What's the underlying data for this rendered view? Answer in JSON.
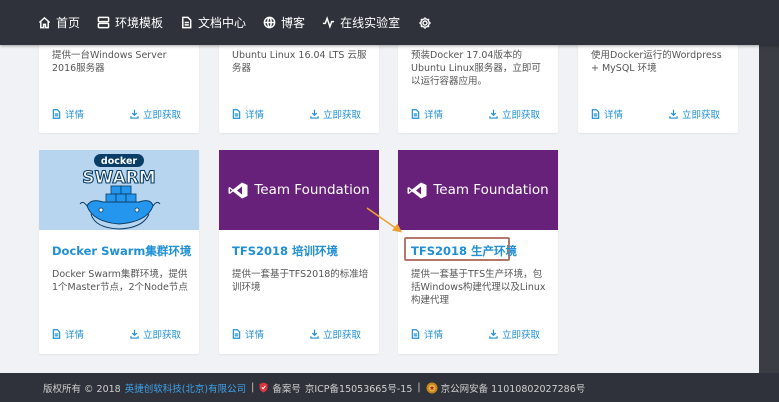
{
  "nav": {
    "items": [
      {
        "label": "首页",
        "icon": "home-icon"
      },
      {
        "label": "环境模板",
        "icon": "template-icon"
      },
      {
        "label": "文档中心",
        "icon": "document-icon"
      },
      {
        "label": "博客",
        "icon": "globe-icon"
      },
      {
        "label": "在线实验室",
        "icon": "pulse-icon"
      }
    ],
    "settings_icon": "gear-icon"
  },
  "cards_top": [
    {
      "desc": "提供一台Windows Server 2016服务器"
    },
    {
      "desc": "Ubuntu Linux 16.04 LTS 云服务器"
    },
    {
      "desc": "预装Docker 17.04版本的Ubuntu Linux服务器，立即可以运行容器应用。"
    },
    {
      "desc": "使用Docker运行的Wordpress + MySQL 环境"
    }
  ],
  "cards_bottom": [
    {
      "title": "Docker Swarm集群环境",
      "desc": "Docker Swarm集群环境，提供1个Master节点，2个Node节点",
      "thumb_text": "docker SWARM"
    },
    {
      "title": "TFS2018 培训环境",
      "desc": "提供一套基于TFS2018的标准培训环境",
      "thumb_text": "Team Foundation"
    },
    {
      "title": "TFS2018 生产环境",
      "desc": "提供一套基于TFS生产环境，包括Windows构建代理以及Linux构建代理",
      "thumb_text": "Team Foundation"
    }
  ],
  "actions": {
    "detail": "详情",
    "get": "立即获取"
  },
  "footer": {
    "copyright": "版权所有 © 2018",
    "company": "英捷创软科技(北京)有限公司",
    "sep": "|",
    "icp_label": "备案号",
    "icp": "京ICP备15053665号-15",
    "police": "京公网安备 11010802027286号"
  },
  "colors": {
    "accent": "#1f8fd6",
    "nav_bg": "#2f323a",
    "tfs_purple": "#68217a",
    "highlight": "#b5776c",
    "arrow": "#f0a030"
  }
}
